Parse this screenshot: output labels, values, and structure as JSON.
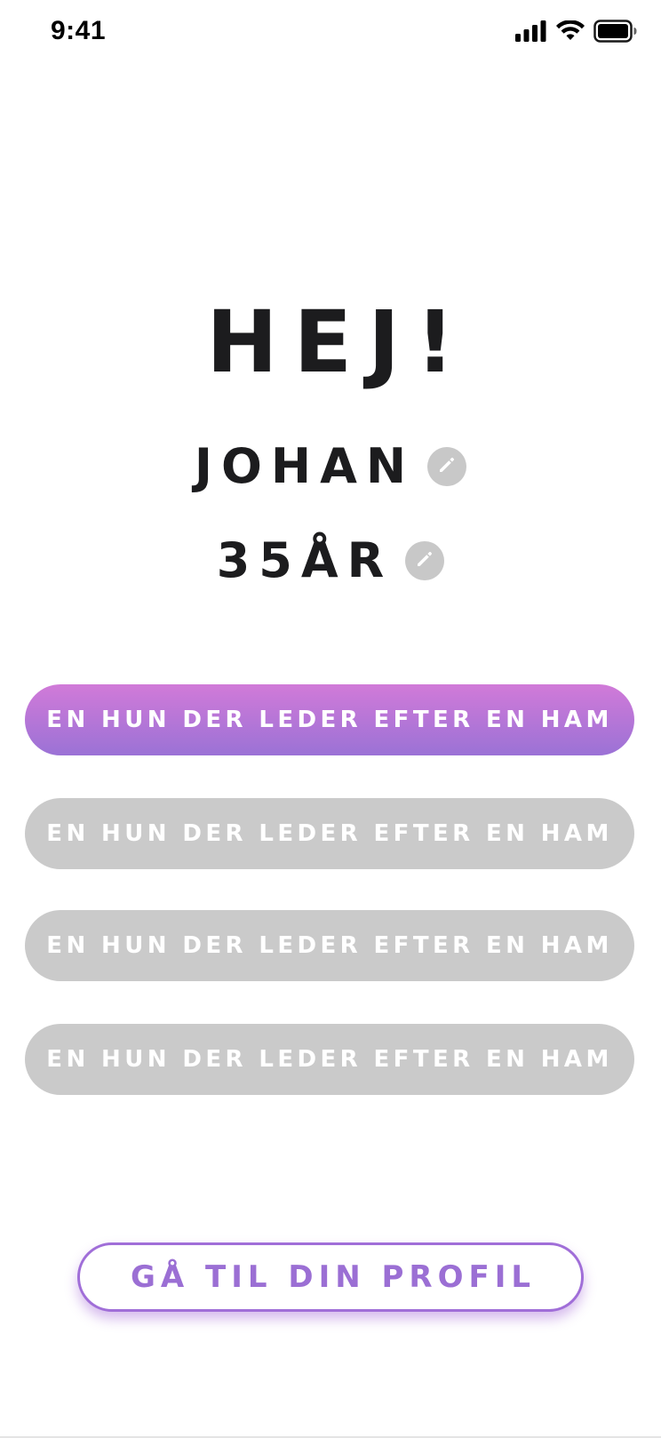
{
  "status_bar": {
    "time": "9:41",
    "icons": [
      "cellular-signal-icon",
      "wifi-icon",
      "battery-icon"
    ]
  },
  "greeting": {
    "title": "HEJ!",
    "name": "JOHAN",
    "age": "35ÅR",
    "edit_icon": "pencil-icon"
  },
  "options": [
    {
      "label": "EN HUN DER LEDER EFTER EN HAM",
      "selected": true
    },
    {
      "label": "EN HUN DER LEDER EFTER EN HAM",
      "selected": false
    },
    {
      "label": "EN HUN DER LEDER EFTER EN HAM",
      "selected": false
    },
    {
      "label": "EN HUN DER LEDER EFTER EN HAM",
      "selected": false
    }
  ],
  "profile_button": {
    "label": "GÅ TIL DIN PROFIL"
  },
  "colors": {
    "accent_start": "#d17ad8",
    "accent_end": "#9b72d6",
    "inactive": "#cacaca",
    "text_dark": "#1c1c1e"
  }
}
